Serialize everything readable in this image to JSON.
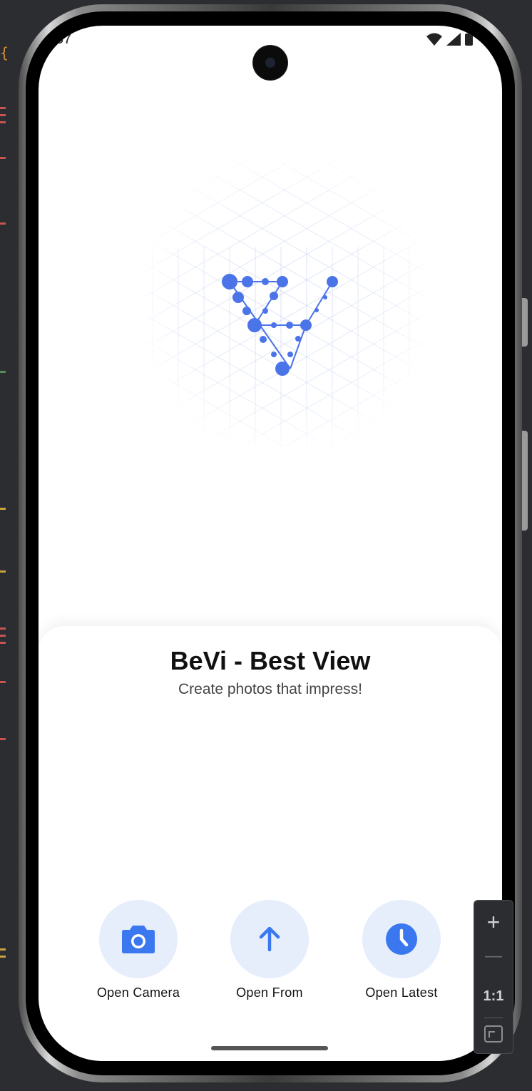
{
  "status_bar": {
    "time": "57"
  },
  "app": {
    "title": "BeVi - Best View",
    "subtitle": "Create photos that impress!"
  },
  "actions": [
    {
      "label": "Open Camera",
      "icon": "camera-icon"
    },
    {
      "label": "Open From",
      "icon": "arrow-up-icon"
    },
    {
      "label": "Open Latest",
      "icon": "clock-icon"
    }
  ],
  "zoom_controls": {
    "zoom_in": "+",
    "zoom_out": "—",
    "actual_size": "1:1"
  },
  "colors": {
    "accent": "#3b78f0",
    "action_bg": "#e6eefc",
    "illustration_dot": "#4a74e8",
    "grid": "#b8c6ec"
  }
}
